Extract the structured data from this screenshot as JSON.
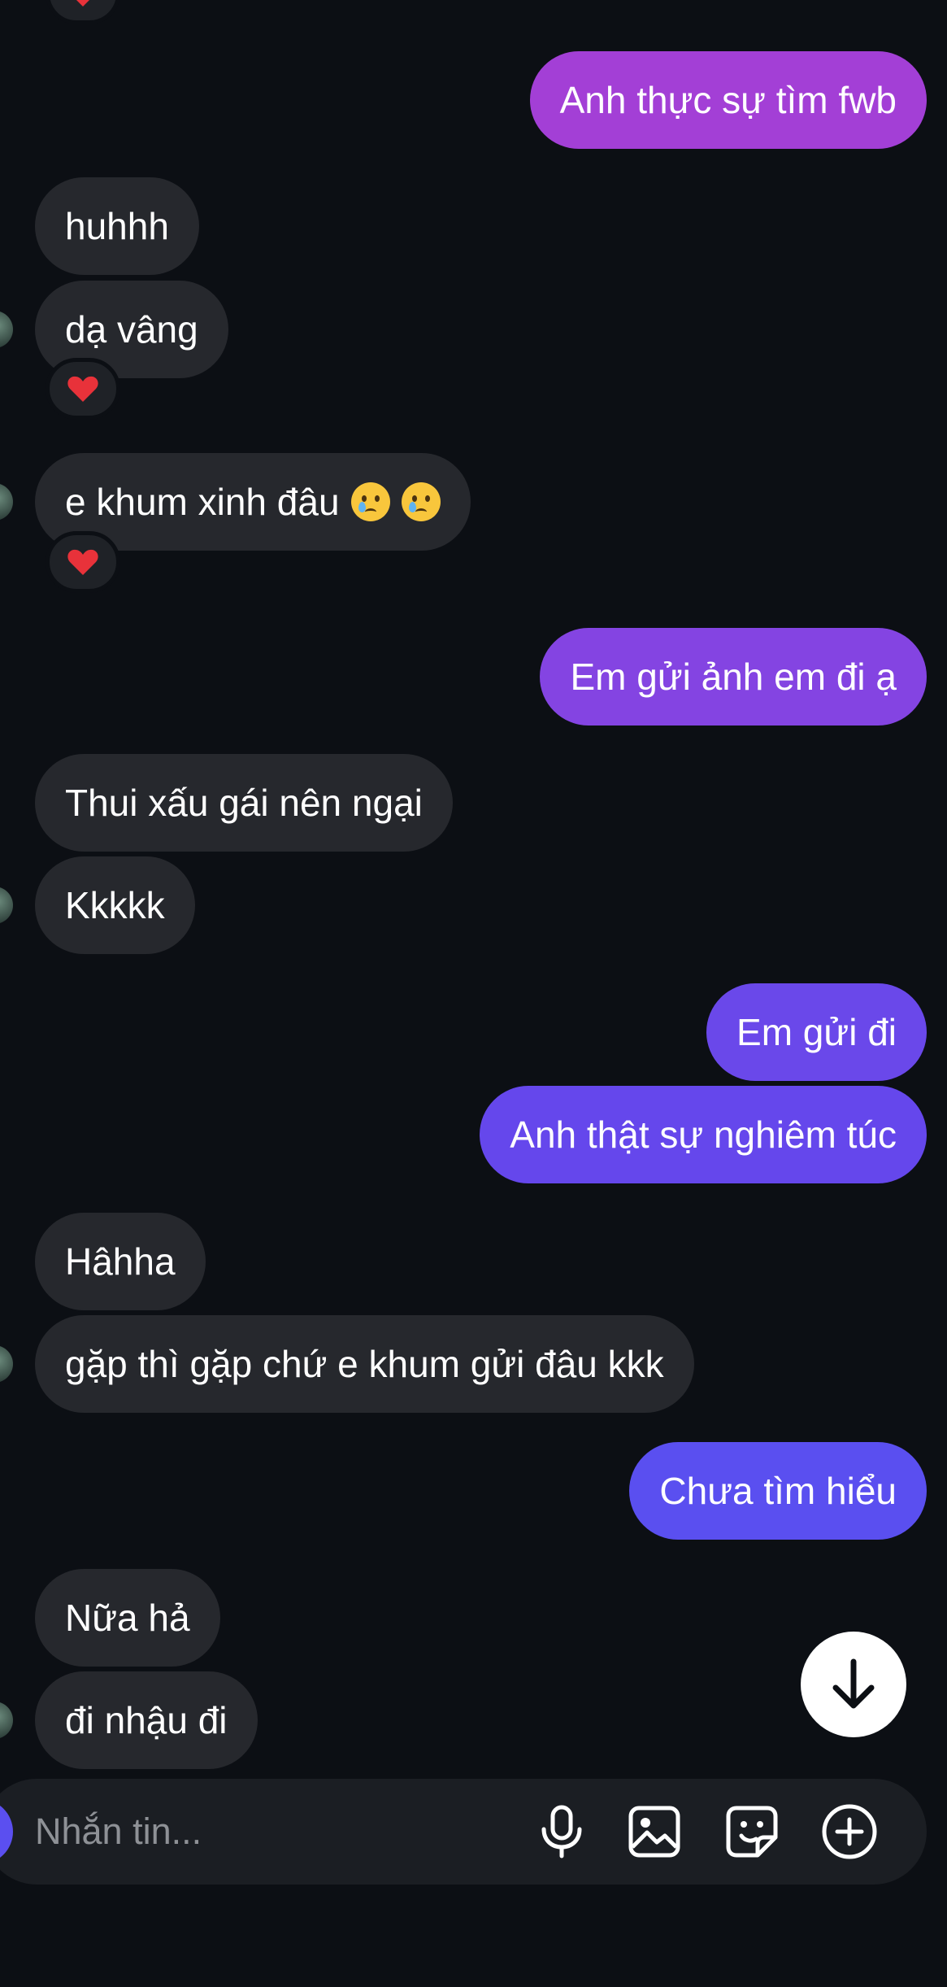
{
  "colors": {
    "background": "#0c0f14",
    "incoming_bubble": "#26282d",
    "outgoing_gradient_top": "#a33fd6",
    "outgoing_gradient_bottom": "#5a4ff0",
    "reaction_heart": "#e8323a"
  },
  "conversation": {
    "messages": [
      {
        "from": "me",
        "text": "Anh thực sự tìm fwb"
      },
      {
        "from": "them",
        "text": "huhhh"
      },
      {
        "from": "them",
        "text": "dạ vâng",
        "reaction": "heart-icon"
      },
      {
        "from": "them",
        "text": "e khum xinh đâu",
        "emoji": [
          "crying-face-icon",
          "crying-face-icon"
        ],
        "reaction": "heart-icon"
      },
      {
        "from": "me",
        "text": "Em gửi ảnh em đi ạ"
      },
      {
        "from": "them",
        "text": "Thui xấu gái nên ngại"
      },
      {
        "from": "them",
        "text": "Kkkkk"
      },
      {
        "from": "me",
        "text": "Em gửi đi"
      },
      {
        "from": "me",
        "text": "Anh thật sự nghiêm túc"
      },
      {
        "from": "them",
        "text": "Hâhha"
      },
      {
        "from": "them",
        "text": "gặp thì gặp chứ e khum gửi đâu kkk"
      },
      {
        "from": "me",
        "text": "Chưa tìm hiểu"
      },
      {
        "from": "them",
        "text": "Nữa hả"
      },
      {
        "from": "them",
        "text": "đi nhậu đi"
      }
    ]
  },
  "composer": {
    "placeholder": "Nhắn tin...",
    "tools": [
      "microphone-icon",
      "image-icon",
      "sticker-icon",
      "add-icon"
    ]
  },
  "scroll_button": {
    "icon": "arrow-down-icon"
  }
}
